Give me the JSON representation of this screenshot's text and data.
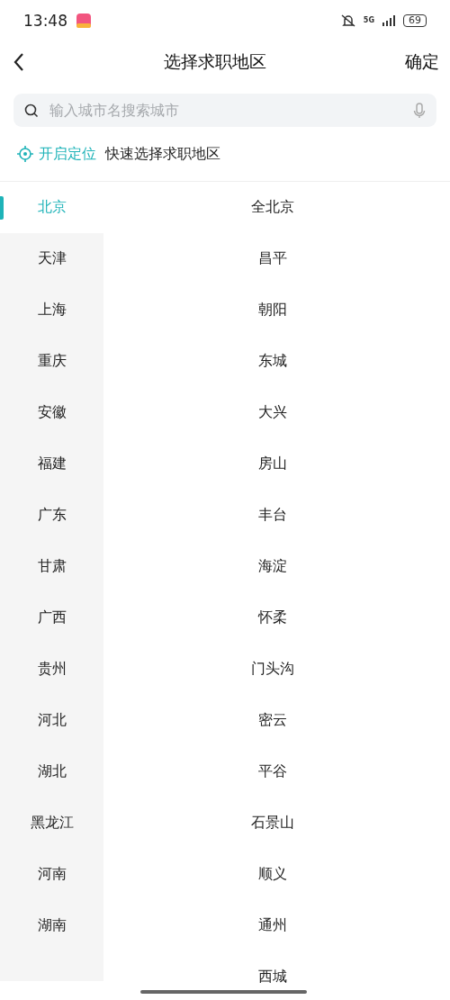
{
  "status_bar": {
    "time": "13:48",
    "network": "5G",
    "battery": "69"
  },
  "header": {
    "title": "选择求职地区",
    "confirm": "确定"
  },
  "search": {
    "placeholder": "输入城市名搜索城市"
  },
  "location": {
    "action": "开启定位",
    "hint": "快速选择求职地区"
  },
  "provinces": [
    {
      "label": "北京",
      "selected": true
    },
    {
      "label": "天津",
      "selected": false
    },
    {
      "label": "上海",
      "selected": false
    },
    {
      "label": "重庆",
      "selected": false
    },
    {
      "label": "安徽",
      "selected": false
    },
    {
      "label": "福建",
      "selected": false
    },
    {
      "label": "广东",
      "selected": false
    },
    {
      "label": "甘肃",
      "selected": false
    },
    {
      "label": "广西",
      "selected": false
    },
    {
      "label": "贵州",
      "selected": false
    },
    {
      "label": "河北",
      "selected": false
    },
    {
      "label": "湖北",
      "selected": false
    },
    {
      "label": "黑龙江",
      "selected": false
    },
    {
      "label": "河南",
      "selected": false
    },
    {
      "label": "湖南",
      "selected": false
    }
  ],
  "districts": [
    "全北京",
    "昌平",
    "朝阳",
    "东城",
    "大兴",
    "房山",
    "丰台",
    "海淀",
    "怀柔",
    "门头沟",
    "密云",
    "平谷",
    "石景山",
    "顺义",
    "通州",
    "西城"
  ]
}
